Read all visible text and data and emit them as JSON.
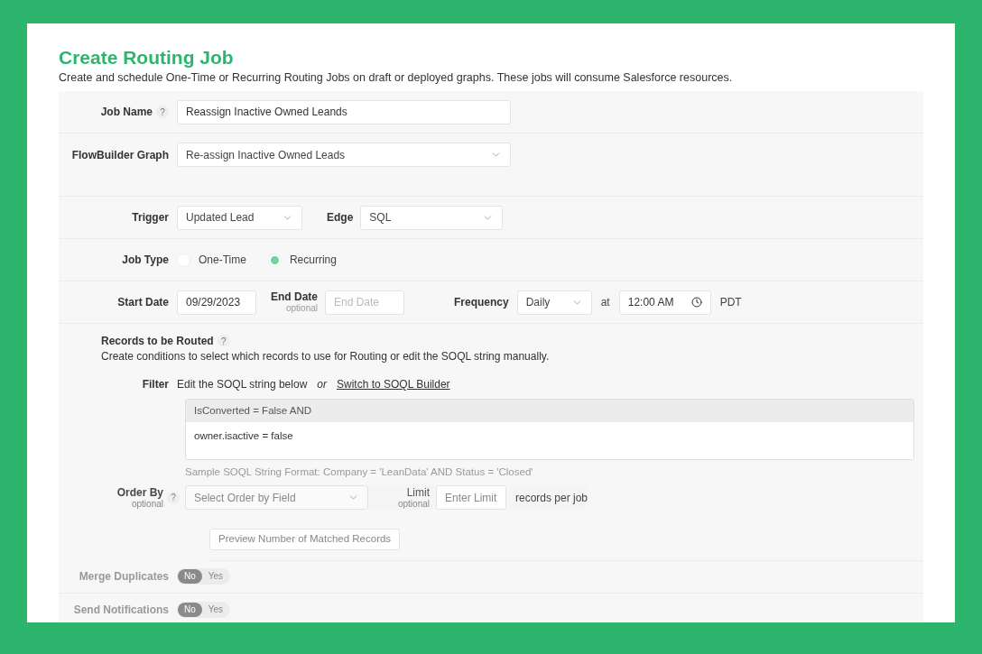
{
  "title": "Create Routing Job",
  "subtitle": "Create and schedule One-Time or Recurring Routing Jobs on draft or deployed graphs. These jobs will consume Salesforce resources.",
  "job_name": {
    "label": "Job Name",
    "help": "?",
    "value": "Reassign Inactive Owned Leands"
  },
  "flowbuilder_graph": {
    "label": "FlowBuilder Graph",
    "value": "Re-assign Inactive Owned Leads"
  },
  "trigger": {
    "label": "Trigger",
    "value": "Updated Lead"
  },
  "edge": {
    "label": "Edge",
    "value": "SQL"
  },
  "job_type": {
    "label": "Job Type",
    "options": [
      {
        "label": "One-Time",
        "selected": false
      },
      {
        "label": "Recurring",
        "selected": true
      }
    ]
  },
  "start_date": {
    "label": "Start Date",
    "value": "09/29/2023"
  },
  "end_date": {
    "label": "End Date",
    "note": "optional",
    "placeholder": "End Date"
  },
  "frequency": {
    "label": "Frequency",
    "value": "Daily",
    "at": "at",
    "time": "12:00 AM",
    "timezone": "PDT"
  },
  "records": {
    "title": "Records to be Routed",
    "help": "?",
    "description": "Create conditions to select which records to use for Routing or edit the SOQL string manually."
  },
  "filter": {
    "label": "Filter",
    "hint": "Edit the SOQL string below",
    "or": "or",
    "link": "Switch to SOQL Builder",
    "prefix": "IsConverted = False AND",
    "value": "owner.isactive = false",
    "sample": "Sample SOQL String Format: Company = 'LeanData' AND Status = 'Closed'"
  },
  "order_by": {
    "label": "Order By",
    "note": "optional",
    "help": "?",
    "placeholder": "Select Order by Field",
    "disabled": true
  },
  "limit": {
    "label": "Limit",
    "note": "optional",
    "placeholder": "Enter Limit",
    "suffix": "records per job",
    "disabled": true
  },
  "preview_button": {
    "label": "Preview Number of Matched Records",
    "disabled": true
  },
  "toggles": [
    {
      "label": "Merge Duplicates",
      "disabled": true,
      "options": [
        {
          "label": "No",
          "selected": true
        },
        {
          "label": "Yes",
          "selected": false
        }
      ]
    },
    {
      "label": "Send Notifications",
      "disabled": true,
      "options": [
        {
          "label": "No",
          "selected": true
        },
        {
          "label": "Yes",
          "selected": false
        }
      ]
    }
  ]
}
